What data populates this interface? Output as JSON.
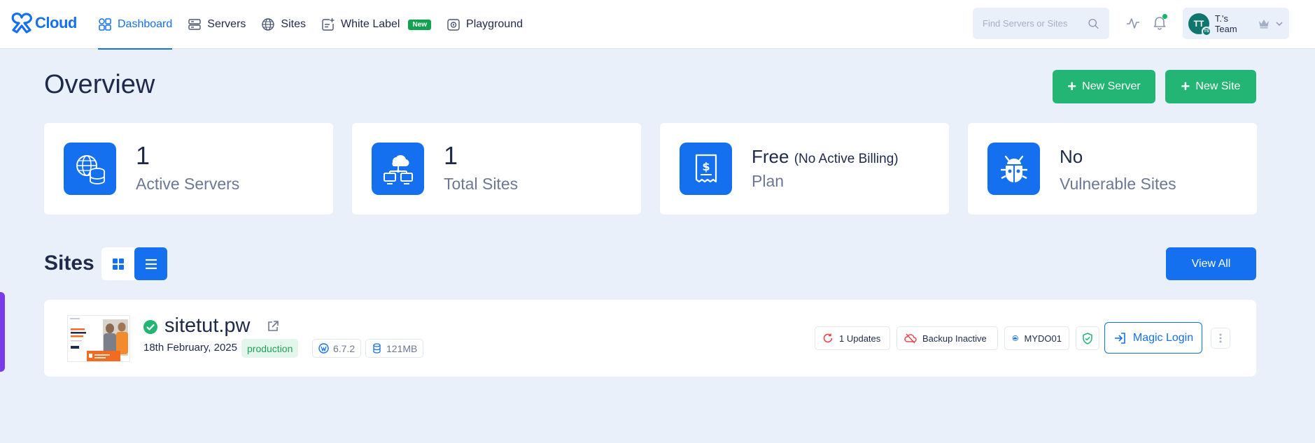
{
  "brand": {
    "name": "Cloud",
    "accent": "#1570ef"
  },
  "nav": {
    "items": [
      {
        "label": "Dashboard",
        "icon": "dashboard-icon",
        "active": true
      },
      {
        "label": "Servers",
        "icon": "servers-icon"
      },
      {
        "label": "Sites",
        "icon": "globe-icon"
      },
      {
        "label": "White Label",
        "icon": "white-label-icon",
        "badge": "New"
      },
      {
        "label": "Playground",
        "icon": "playground-icon"
      }
    ]
  },
  "search": {
    "placeholder": "Find Servers or Sites"
  },
  "team": {
    "initials": "TT",
    "sub_initials": "TS",
    "name": "T.'s Team"
  },
  "overview": {
    "title": "Overview",
    "new_server_label": "New Server",
    "new_site_label": "New Site",
    "stats": [
      {
        "value": "1",
        "label": "Active Servers",
        "icon": "servers-globe-icon"
      },
      {
        "value": "1",
        "label": "Total Sites",
        "icon": "network-icon"
      },
      {
        "value": "Free",
        "value_note": "(No Active Billing)",
        "label": "Plan",
        "icon": "billing-icon"
      },
      {
        "value": "No",
        "label": "Vulnerable Sites",
        "icon": "bug-icon"
      }
    ]
  },
  "sites": {
    "title": "Sites",
    "view_all_label": "View All",
    "items": [
      {
        "name": "sitetut.pw",
        "date": "18th February, 2025",
        "environment": "production",
        "wp_version": "6.7.2",
        "size": "121MB",
        "updates": "1 Updates",
        "backup": "Backup Inactive",
        "server": "MYDO01",
        "magic_login": "Magic Login"
      }
    ]
  },
  "colors": {
    "green": "#22b573",
    "blue": "#1570ef",
    "bg": "#eaf0fa"
  }
}
